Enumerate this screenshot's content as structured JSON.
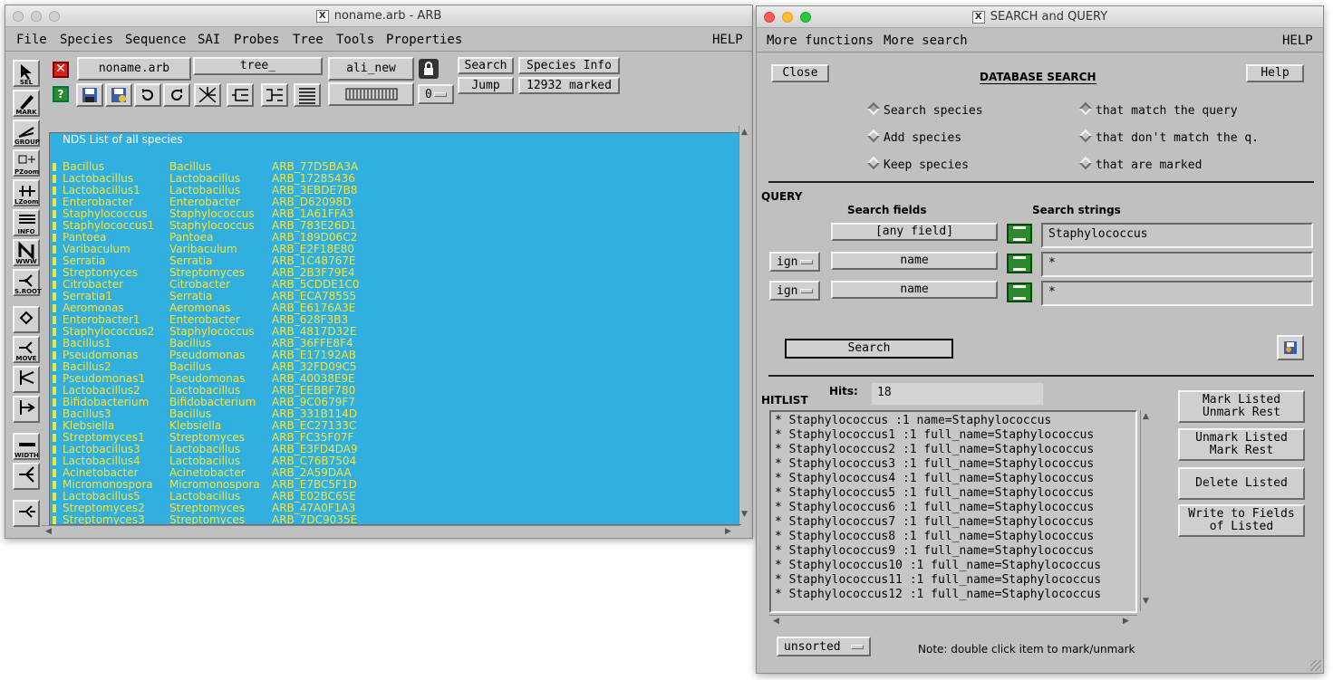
{
  "arb_window": {
    "title": "noname.arb - ARB",
    "menu": [
      "File",
      "Species",
      "Sequence",
      "SAI",
      "Probes",
      "Tree",
      "Tools",
      "Properties"
    ],
    "help": "HELP",
    "db_name": "noname.arb",
    "tree_name": "tree_",
    "alignment": "ali_new",
    "search_label": "Search",
    "species_info_label": "Species Info",
    "jump_label": "Jump",
    "marked_label": "12932 marked",
    "zero_option": "0",
    "tool_labels": [
      "SEL",
      "MARK",
      "GROUP",
      "PZoom",
      "LZoom",
      "INFO",
      "WWW",
      "S.ROOT",
      "",
      "MOVE",
      "",
      "",
      "WIDTH",
      "",
      ""
    ],
    "nds_header": "NDS List of all species",
    "species": [
      [
        "Bacillus",
        "Bacillus",
        "ARB_77D5BA3A"
      ],
      [
        "Lactobacillus",
        "Lactobacillus",
        "ARB_17285436"
      ],
      [
        "Lactobacillus1",
        "Lactobacillus",
        "ARB_3EBDE7B8"
      ],
      [
        "Enterobacter",
        "Enterobacter",
        "ARB_D62098D"
      ],
      [
        "Staphylococcus",
        "Staphylococcus",
        "ARB_1A61FFA3"
      ],
      [
        "Staphylococcus1",
        "Staphylococcus",
        "ARB_783E26D1"
      ],
      [
        "Pantoea",
        "Pantoea",
        "ARB_189D06C2"
      ],
      [
        "Varibaculum",
        "Varibaculum",
        "ARB_E2F18E80"
      ],
      [
        "Serratia",
        "Serratia",
        "ARB_1C48767E"
      ],
      [
        "Streptomyces",
        "Streptomyces",
        "ARB_2B3F79E4"
      ],
      [
        "Citrobacter",
        "Citrobacter",
        "ARB_5CDDE1C0"
      ],
      [
        "Serratia1",
        "Serratia",
        "ARB_ECA78555"
      ],
      [
        "Aeromonas",
        "Aeromonas",
        "ARB_E6176A3E"
      ],
      [
        "Enterobacter1",
        "Enterobacter",
        "ARB_628F3B3"
      ],
      [
        "Staphylococcus2",
        "Staphylococcus",
        "ARB_4817D32E"
      ],
      [
        "Bacillus1",
        "Bacillus",
        "ARB_36FFE8F4"
      ],
      [
        "Pseudomonas",
        "Pseudomonas",
        "ARB_E17192AB"
      ],
      [
        "Bacillus2",
        "Bacillus",
        "ARB_32FD09C5"
      ],
      [
        "Pseudomonas1",
        "Pseudomonas",
        "ARB_40038E9E"
      ],
      [
        "Lactobacillus2",
        "Lactobacillus",
        "ARB_EEBBF780"
      ],
      [
        "Bifidobacterium",
        "Bifidobacterium",
        "ARB_9C0679F7"
      ],
      [
        "Bacillus3",
        "Bacillus",
        "ARB_331B114D"
      ],
      [
        "Klebsiella",
        "Klebsiella",
        "ARB_EC27133C"
      ],
      [
        "Streptomyces1",
        "Streptomyces",
        "ARB_FC35F07F"
      ],
      [
        "Lactobacillus3",
        "Lactobacillus",
        "ARB_E3FD4DA9"
      ],
      [
        "Lactobacillus4",
        "Lactobacillus",
        "ARB_C76B7504"
      ],
      [
        "Acinetobacter",
        "Acinetobacter",
        "ARB_2A59DAA"
      ],
      [
        "Micromonospora",
        "Micromonospora",
        "ARB_E7BC5F1D"
      ],
      [
        "Lactobacillus5",
        "Lactobacillus",
        "ARB_E02BC65E"
      ],
      [
        "Streptomyces2",
        "Streptomyces",
        "ARB_47A0F1A3"
      ],
      [
        "Streptomyces3",
        "Streptomyces",
        "ARB_7DC9035E"
      ]
    ]
  },
  "search_window": {
    "title": "SEARCH and QUERY",
    "menu_more_functions": "More functions",
    "menu_more_search": "More search",
    "help": "HELP",
    "close_label": "Close",
    "help_button": "Help",
    "heading": "DATABASE SEARCH",
    "radio_left": [
      "Search species",
      "Add species",
      "Keep species"
    ],
    "radio_right": [
      "that match the query",
      "that don't match the q.",
      "that are marked"
    ],
    "query_label": "QUERY",
    "search_fields_label": "Search fields",
    "search_strings_label": "Search strings",
    "rows": [
      {
        "op": "",
        "field": "[any field]",
        "value": "Staphylococcus"
      },
      {
        "op": "ign",
        "field": "name",
        "value": "*"
      },
      {
        "op": "ign",
        "field": "name",
        "value": "*"
      }
    ],
    "search_button": "Search",
    "hitlist_label": "HITLIST",
    "hits_label": "Hits:",
    "hits_value": "18",
    "hits": [
      "* Staphylococcus :1 name=Staphylococcus",
      "* Staphylococcus1 :1 full_name=Staphylococcus",
      "* Staphylococcus2 :1 full_name=Staphylococcus",
      "* Staphylococcus3 :1 full_name=Staphylococcus",
      "* Staphylococcus4 :1 full_name=Staphylococcus",
      "* Staphylococcus5 :1 full_name=Staphylococcus",
      "* Staphylococcus6 :1 full_name=Staphylococcus",
      "* Staphylococcus7 :1 full_name=Staphylococcus",
      "* Staphylococcus8 :1 full_name=Staphylococcus",
      "* Staphylococcus9 :1 full_name=Staphylococcus",
      "* Staphylococcus10 :1 full_name=Staphylococcus",
      "* Staphylococcus11 :1 full_name=Staphylococcus",
      "* Staphylococcus12 :1 full_name=Staphylococcus"
    ],
    "mark_listed": "Mark Listed\nUnmark Rest",
    "unmark_listed": "Unmark Listed\nMark Rest",
    "delete_listed": "Delete Listed",
    "write_fields": "Write to Fields\nof Listed",
    "sort_option": "unsorted",
    "note": "Note: double click item to mark/unmark"
  }
}
